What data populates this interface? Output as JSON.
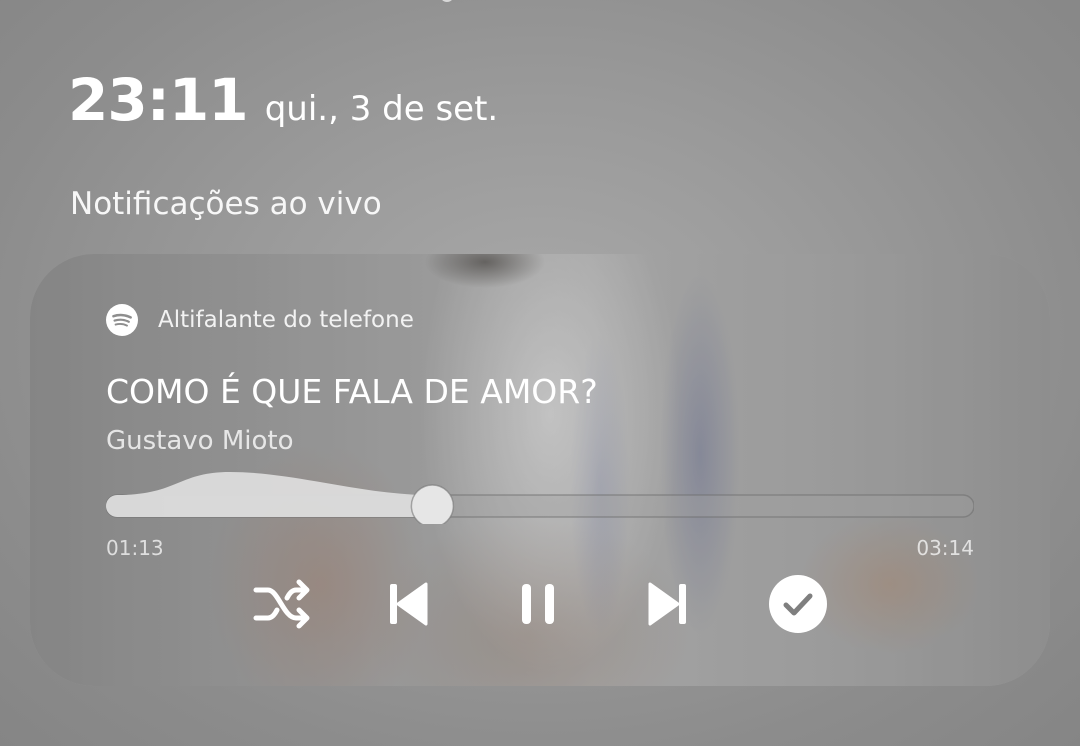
{
  "lockscreen": {
    "time": "23:11",
    "date": "qui., 3 de set."
  },
  "live_notifications": {
    "title": "Notificações ao vivo"
  },
  "media_card": {
    "app_icon": "spotify-icon",
    "output_device": "Altifalante do telefone",
    "track_title": "COMO É QUE FALA DE AMOR?",
    "artist": "Gustavo Mioto",
    "elapsed": "01:13",
    "duration": "03:14",
    "progress_fraction": 0.376,
    "state": "playing",
    "controls": {
      "shuffle": "shuffle-icon",
      "previous": "skip-previous-icon",
      "play_pause": "pause-icon",
      "next": "skip-next-icon",
      "saved": "check-circle-icon"
    }
  }
}
